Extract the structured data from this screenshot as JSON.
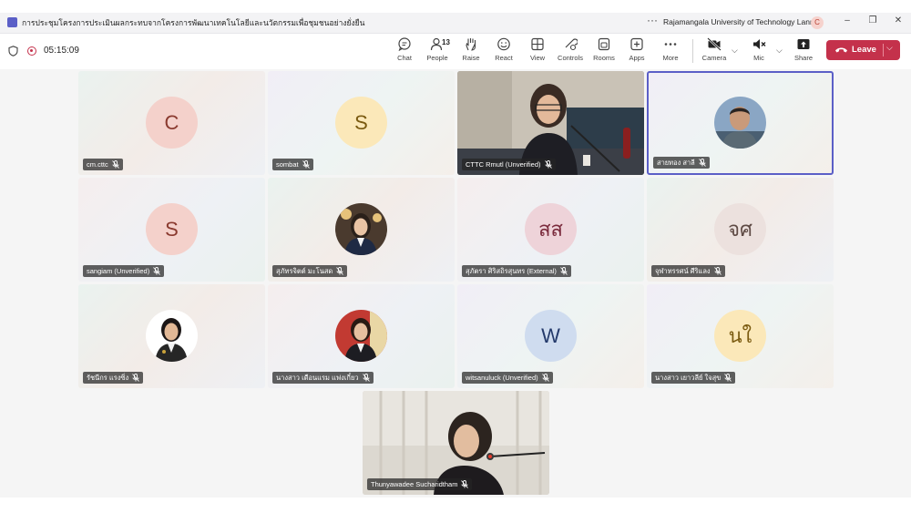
{
  "window": {
    "title": "การประชุมโครงการประเมินผลกระทบจากโครงการพัฒนาเทคโนโลยีและนวัตกรรมเพื่อชุมชนอย่างยั่งยืน",
    "org": "Rajamangala University of Technology Lanna",
    "account_initial": "C"
  },
  "toolbar": {
    "timer": "05:15:09",
    "people_count": "13",
    "buttons": {
      "chat": "Chat",
      "people": "People",
      "raise": "Raise",
      "react": "React",
      "view": "View",
      "controls": "Controls",
      "rooms": "Rooms",
      "apps": "Apps",
      "more": "More",
      "camera": "Camera",
      "mic": "Mic",
      "share": "Share"
    },
    "leave": "Leave"
  },
  "participants": [
    {
      "name": "cm.cttc",
      "initials": "C",
      "avatar_bg": "#f4d1cb",
      "avatar_fg": "#8a3a2f"
    },
    {
      "name": "sombat",
      "initials": "S",
      "avatar_bg": "#fbe8b9",
      "avatar_fg": "#7a5a10"
    },
    {
      "name": "CTTC Rmutl (Unverified)",
      "initials": ""
    },
    {
      "name": "สายทอง สาลี",
      "initials": ""
    },
    {
      "name": "sangiam (Unverified)",
      "initials": "S",
      "avatar_bg": "#f4d1cb",
      "avatar_fg": "#8a3a2f"
    },
    {
      "name": "สุภัทรจิตต์ มะโนสด",
      "initials": ""
    },
    {
      "name": "สุภัตรา ศิริสถิรสุนทร (External)",
      "initials": "สส",
      "avatar_bg": "#eed3d9",
      "avatar_fg": "#7a2a3c"
    },
    {
      "name": "จุฬาทรรศน์ ศีริแลง",
      "initials": "จศ",
      "avatar_bg": "#ece1de",
      "avatar_fg": "#5e4a44"
    },
    {
      "name": "รัชนีกร แรงซิ่ง",
      "initials": ""
    },
    {
      "name": "นางสาว เดือนแรม แฟงเกี๋ยว",
      "initials": ""
    },
    {
      "name": "witsanuluck (Unverified)",
      "initials": "W",
      "avatar_bg": "#cfdcef",
      "avatar_fg": "#243a6b"
    },
    {
      "name": "นางสาว เยาวลีย์ ใจสุข",
      "initials": "นใ",
      "avatar_bg": "#fbe8b9",
      "avatar_fg": "#7a5a10"
    },
    {
      "name": "Thunyawadee Sucharidtham",
      "initials": ""
    }
  ],
  "colors": {
    "accent": "#5b5fc7",
    "leave": "#c4314b"
  }
}
